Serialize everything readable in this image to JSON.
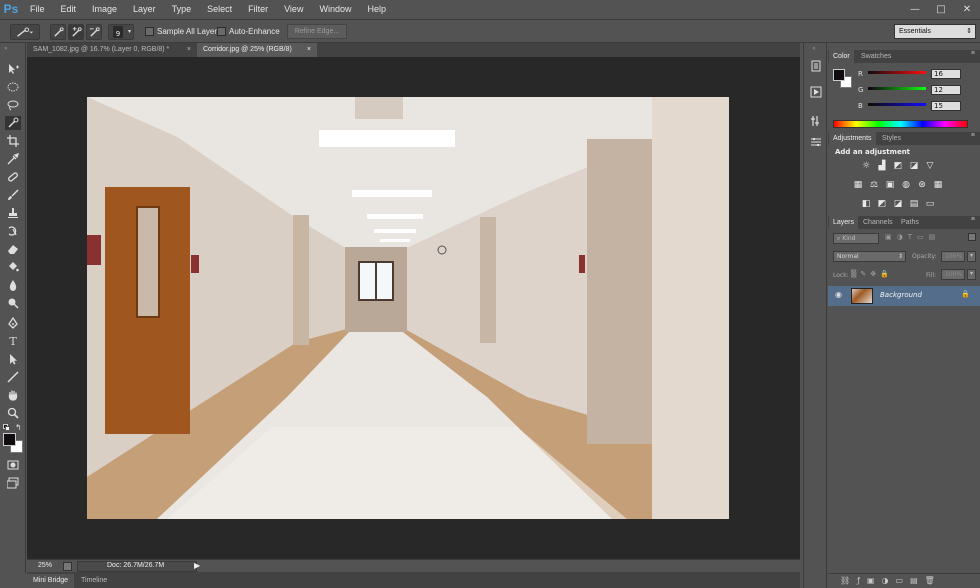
{
  "app": {
    "logo": "Ps"
  },
  "menu": [
    "File",
    "Edit",
    "Image",
    "Layer",
    "Type",
    "Select",
    "Filter",
    "View",
    "Window",
    "Help"
  ],
  "window_controls": {
    "minimize": "—",
    "maximize": "□",
    "close": "✕"
  },
  "options_bar": {
    "brush_size": "9",
    "sample_all_layers": "Sample All Layers",
    "auto_enhance": "Auto-Enhance",
    "refine_edge": "Refine Edge...",
    "workspace": "Essentials"
  },
  "tabs": [
    {
      "label": "SAM_1082.jpg @ 16.7% (Layer 0, RGB/8) *",
      "close": "×"
    },
    {
      "label": "Corridor.jpg @ 25% (RGB/8)",
      "close": "×"
    }
  ],
  "status": {
    "zoom": "25%",
    "doc": "Doc: 26.7M/26.7M"
  },
  "bottom_tabs": [
    "Mini Bridge",
    "Timeline"
  ],
  "color_panel": {
    "tabs": [
      "Color",
      "Swatches"
    ],
    "r_label": "R",
    "g_label": "G",
    "b_label": "B",
    "r": "16",
    "g": "12",
    "b": "15"
  },
  "adjustments_panel": {
    "tabs": [
      "Adjustments",
      "Styles"
    ],
    "heading": "Add an adjustment"
  },
  "layers_panel": {
    "tabs": [
      "Layers",
      "Channels",
      "Paths"
    ],
    "kind": "Kind",
    "blend_mode": "Normal",
    "opacity_label": "Opacity:",
    "opacity": "100%",
    "lock_label": "Lock:",
    "fill_label": "Fill:",
    "fill": "100%",
    "layer_name": "Background"
  },
  "colors": {
    "accent": "#4fa3e0",
    "selected_layer": "#536d8a"
  }
}
